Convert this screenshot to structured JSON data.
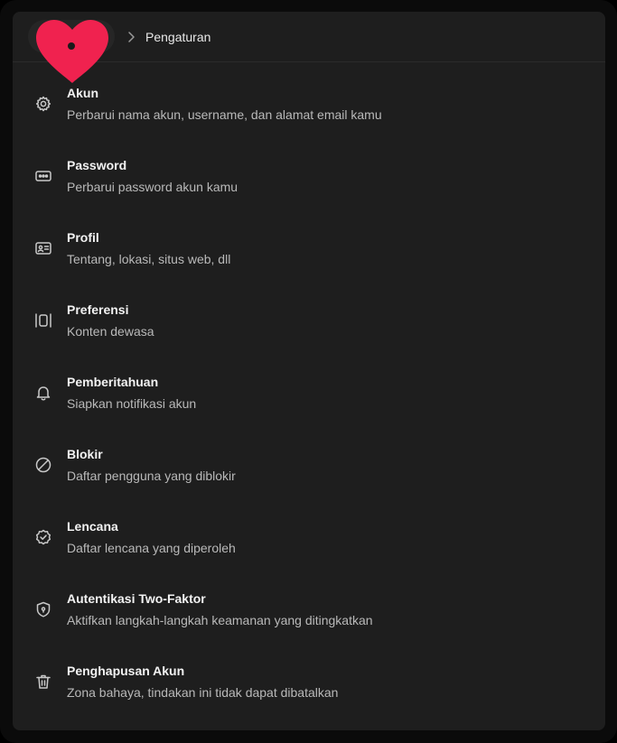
{
  "header": {
    "breadcrumb_label": "Pengaturan",
    "logo_icon": "heart-icon",
    "logo_color": "#f0224f"
  },
  "settings": {
    "items": [
      {
        "title": "Akun",
        "description": "Perbarui nama akun, username, dan alamat email kamu",
        "icon": "gear-icon"
      },
      {
        "title": "Password",
        "description": "Perbarui password akun kamu",
        "icon": "password-dots-icon"
      },
      {
        "title": "Profil",
        "description": "Tentang, lokasi, situs web, dll",
        "icon": "id-card-icon"
      },
      {
        "title": "Preferensi",
        "description": "Konten dewasa",
        "icon": "columns-icon"
      },
      {
        "title": "Pemberitahuan",
        "description": "Siapkan notifikasi akun",
        "icon": "bell-icon"
      },
      {
        "title": "Blokir",
        "description": "Daftar pengguna yang diblokir",
        "icon": "block-icon"
      },
      {
        "title": "Lencana",
        "description": "Daftar lencana yang diperoleh",
        "icon": "badge-check-icon"
      },
      {
        "title": "Autentikasi Two-Faktor",
        "description": "Aktifkan langkah-langkah keamanan yang ditingkatkan",
        "icon": "shield-icon"
      },
      {
        "title": "Penghapusan Akun",
        "description": "Zona bahaya, tindakan ini tidak dapat dibatalkan",
        "icon": "trash-icon"
      }
    ]
  },
  "theme": {
    "background": "#1e1e1e",
    "text_primary": "#f2f2f2",
    "text_secondary": "#b9b9b9"
  }
}
